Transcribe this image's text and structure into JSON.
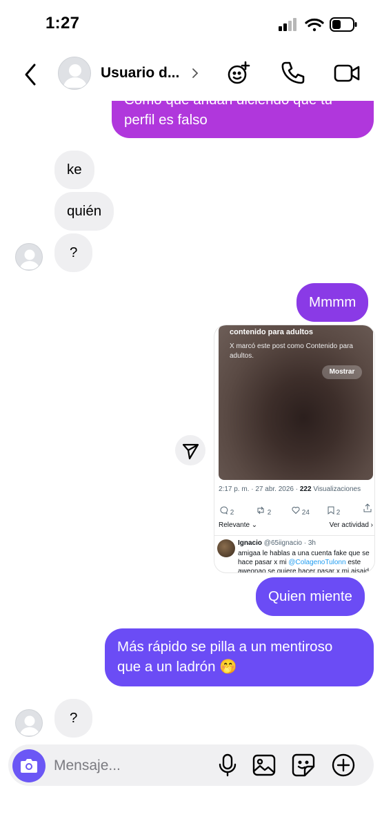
{
  "status_bar": {
    "time": "1:27"
  },
  "header": {
    "contact_name": "Usuario d..."
  },
  "messages": {
    "m1": "Como que andan diciendo que tu perfil es falso",
    "m1_line1": "Como que andan diciendo que tu",
    "m1_line2": "perfil es falso",
    "m2": "ke",
    "m3": "quién",
    "m4": "?",
    "m5": "Mmmm",
    "m6": "Quien miente",
    "m7_line1": "Más rápido se pilla a un mentiroso",
    "m7_line2": "que a un ladrón 🤭",
    "m8": "?"
  },
  "shared_post": {
    "title": "contenido para adultos",
    "subtitle": "X marcó este post como Contenido para adultos.",
    "show_button": "Mostrar",
    "time": "2:17 p. m. · 27 abr. 2026 ·",
    "views_count": "222",
    "views_label": "Visualizaciones",
    "replies": "2",
    "reposts": "2",
    "likes": "24",
    "bookmarks": "2",
    "sort_label": "Relevante",
    "activity_label": "Ver actividad",
    "reply_name": "Ignacio",
    "reply_handle": "@65iignacio · 3h",
    "reply_text_1": "amigaa le hablas a una cuenta fake que se hace pasar x mi ",
    "reply_mention": "@ColagenoTulonn",
    "reply_text_2": " este aweonao se quiere hacer pasar x mi aisaid"
  },
  "composer": {
    "placeholder": "Mensaje..."
  },
  "colors": {
    "out_bubble_purple": "#b037dc",
    "out_bubble_violet": "#8a3ae6",
    "out_bubble_indigo": "#6b4cf5",
    "incoming_bubble": "#efeff1",
    "camera_button": "#6b57f5"
  },
  "icons": [
    "back-icon",
    "chevron-right-icon",
    "group-add-icon",
    "phone-icon",
    "video-icon",
    "share-send-icon",
    "camera-icon",
    "microphone-icon",
    "gallery-icon",
    "sticker-icon",
    "plus-icon",
    "signal-icon",
    "wifi-icon",
    "battery-icon"
  ]
}
